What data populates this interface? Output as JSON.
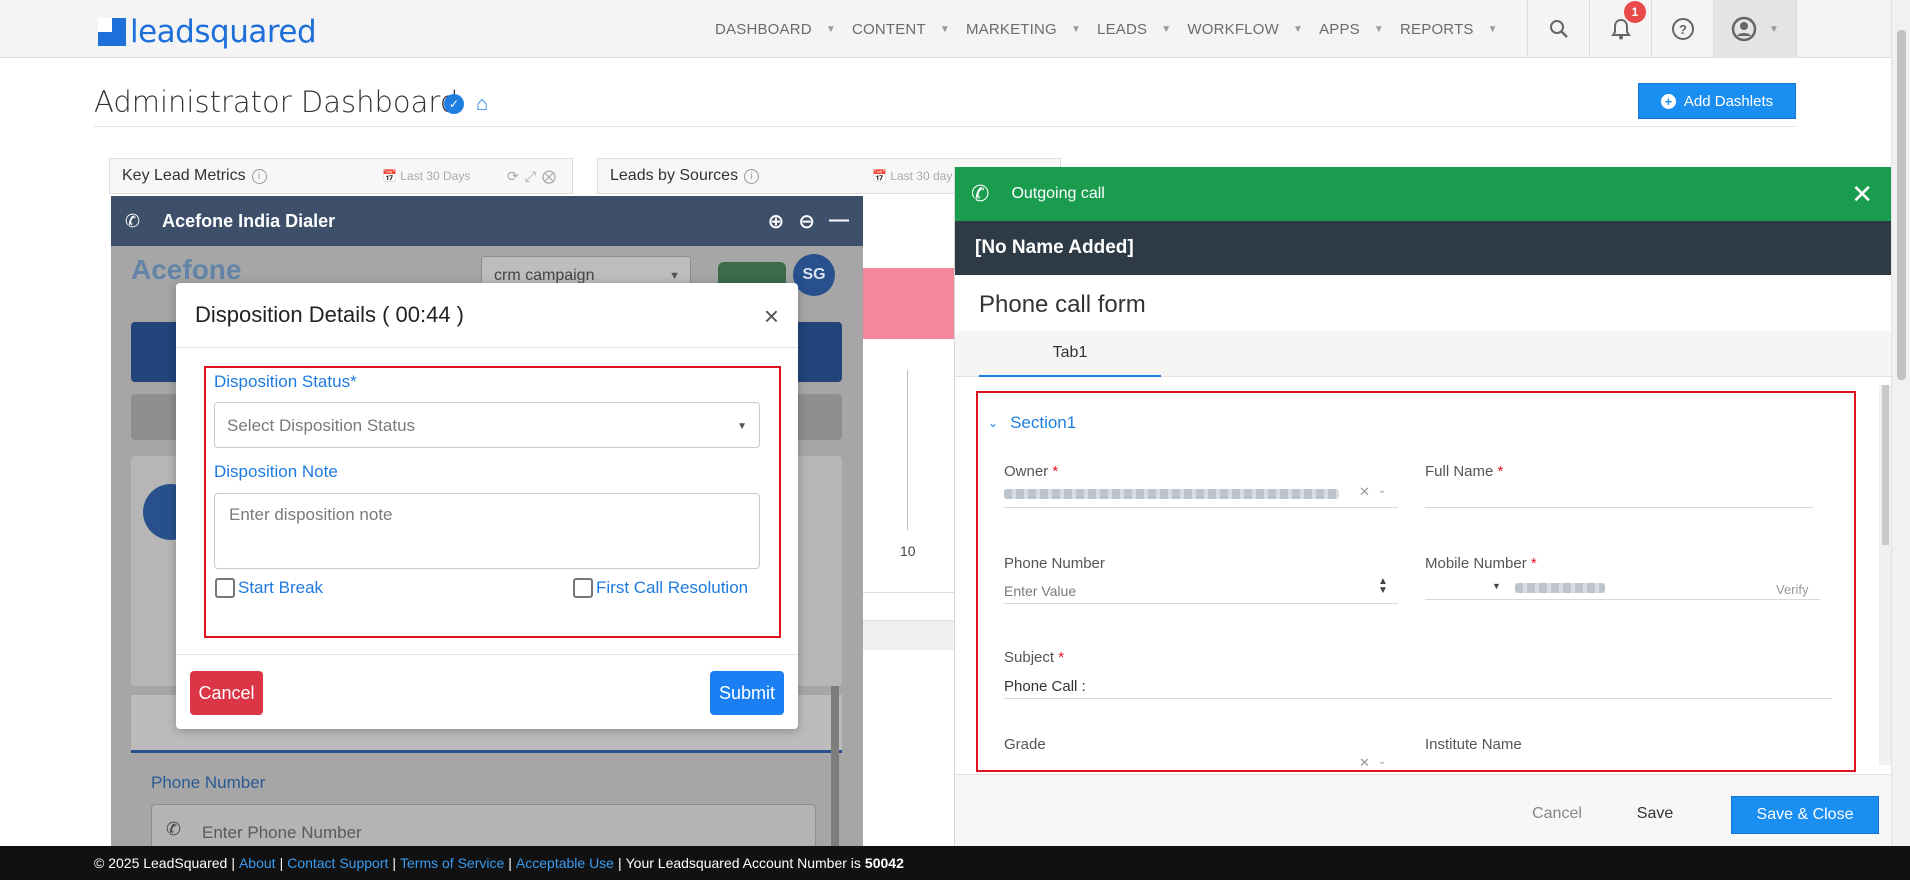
{
  "brand": {
    "name": "leadsquared"
  },
  "nav": {
    "items": [
      {
        "label": "DASHBOARD"
      },
      {
        "label": "CONTENT"
      },
      {
        "label": "MARKETING"
      },
      {
        "label": "LEADS"
      },
      {
        "label": "WORKFLOW"
      },
      {
        "label": "APPS"
      },
      {
        "label": "REPORTS"
      }
    ],
    "notification_count": "1",
    "icons": [
      "search-icon",
      "bell-icon",
      "help-icon",
      "user-icon"
    ]
  },
  "page": {
    "title": "Administrator Dashboard",
    "add_dashlets_label": "Add Dashlets"
  },
  "dashlets": [
    {
      "title": "Key Lead Metrics",
      "range": "Last 30 Days"
    },
    {
      "title": "Leads by Sources",
      "range": "Last 30 day"
    }
  ],
  "chart": {
    "tick_label": "10"
  },
  "dialer": {
    "title": "Acefone India Dialer",
    "logo_text": "Acefone",
    "campaign": "crm campaign",
    "avatar_initials": "SG",
    "phone_label": "Phone Number",
    "phone_placeholder": "Enter Phone Number"
  },
  "disposition": {
    "title": "Disposition Details ( 00:44 )",
    "status_label": "Disposition Status*",
    "status_placeholder": "Select Disposition Status",
    "note_label": "Disposition Note",
    "note_placeholder": "Enter disposition note",
    "start_break_label": "Start Break",
    "first_call_resolution_label": "First Call Resolution",
    "cancel_label": "Cancel",
    "submit_label": "Submit"
  },
  "call_panel": {
    "header": "Outgoing call",
    "name": "[No Name Added]",
    "form_title": "Phone call form",
    "tab": "Tab1",
    "section": "Section1",
    "fields": {
      "owner": "Owner",
      "full_name": "Full Name",
      "phone_number": "Phone Number",
      "phone_placeholder": "Enter Value",
      "mobile_number": "Mobile Number",
      "verify": "Verify",
      "subject": "Subject",
      "subject_value": "Phone Call :",
      "grade": "Grade",
      "institute_name": "Institute Name"
    },
    "cancel_label": "Cancel",
    "save_label": "Save",
    "save_close_label": "Save & Close"
  },
  "footer": {
    "copyright": "© 2025 LeadSquared",
    "links": [
      "About",
      "Contact Support",
      "Terms of Service",
      "Acceptable Use"
    ],
    "account_text": "Your Leadsquared Account Number is",
    "account_number": "50042"
  }
}
